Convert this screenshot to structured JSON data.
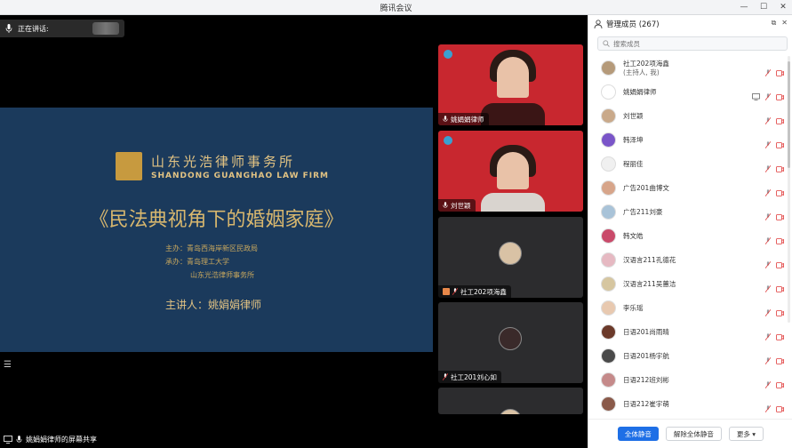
{
  "window": {
    "title": "腾讯会议"
  },
  "speaking": {
    "label": "正在讲话:"
  },
  "slide": {
    "firm_cn": "山东光浩律师事务所",
    "firm_en": "SHANDONG GUANGHAO LAW FIRM",
    "headline": "《民法典视角下的婚姻家庭》",
    "organizer": "主办：青岛西海岸新区民政局",
    "host1": "承办：青岛理工大学",
    "host2": "山东光浩律师事务所",
    "speaker": "主讲人：姚娟娟律师"
  },
  "share": {
    "label": "姚娟娟律师的屏幕共享"
  },
  "thumbnails": [
    {
      "name": "姚娟娟律师",
      "style": "red"
    },
    {
      "name": "刘世颖",
      "style": "red"
    },
    {
      "name": "社工202项海鑫",
      "style": "dark"
    },
    {
      "name": "社工201刘心如",
      "style": "dark"
    },
    {
      "name": "",
      "style": "dark"
    }
  ],
  "panel": {
    "title": "管理成员 (267)",
    "search_placeholder": "搜索成员",
    "members": [
      {
        "name": "社工202项海鑫",
        "sub": "(主持人, 我)",
        "avatar_color": "#b59a7a"
      },
      {
        "name": "姚娟娟律师",
        "sub": "",
        "avatar_color": "#ffffff"
      },
      {
        "name": "刘世颖",
        "sub": "",
        "avatar_color": "#c9a98a"
      },
      {
        "name": "韩泽坤",
        "sub": "",
        "avatar_color": "#7a55c8"
      },
      {
        "name": "程丽佳",
        "sub": "",
        "avatar_color": "#f0f0f0"
      },
      {
        "name": "广告201曲博文",
        "sub": "",
        "avatar_color": "#d7a58a"
      },
      {
        "name": "广告211刘豪",
        "sub": "",
        "avatar_color": "#a9c3d8"
      },
      {
        "name": "韩文皓",
        "sub": "",
        "avatar_color": "#c94a6a"
      },
      {
        "name": "汉语言211孔德花",
        "sub": "",
        "avatar_color": "#e6b9c2"
      },
      {
        "name": "汉语言211吴蕙洁",
        "sub": "",
        "avatar_color": "#d6c6a0"
      },
      {
        "name": "李乐瑶",
        "sub": "",
        "avatar_color": "#e8c9b0"
      },
      {
        "name": "日语201尚雨晴",
        "sub": "",
        "avatar_color": "#6b3a2a"
      },
      {
        "name": "日语201杨宇航",
        "sub": "",
        "avatar_color": "#4a4a4a"
      },
      {
        "name": "日语212班刘彬",
        "sub": "",
        "avatar_color": "#c58a8a"
      },
      {
        "name": "日语212崔宇萌",
        "sub": "",
        "avatar_color": "#8a5a4a"
      }
    ],
    "buttons": {
      "mute_all": "全体静音",
      "unmute_all": "解除全体静音",
      "more": "更多 ▾"
    }
  },
  "colors": {
    "accent": "#1e6fe6",
    "slide_bg": "#1b3a5c",
    "gold": "#d8b76e",
    "muted_red": "#e03a3a"
  }
}
